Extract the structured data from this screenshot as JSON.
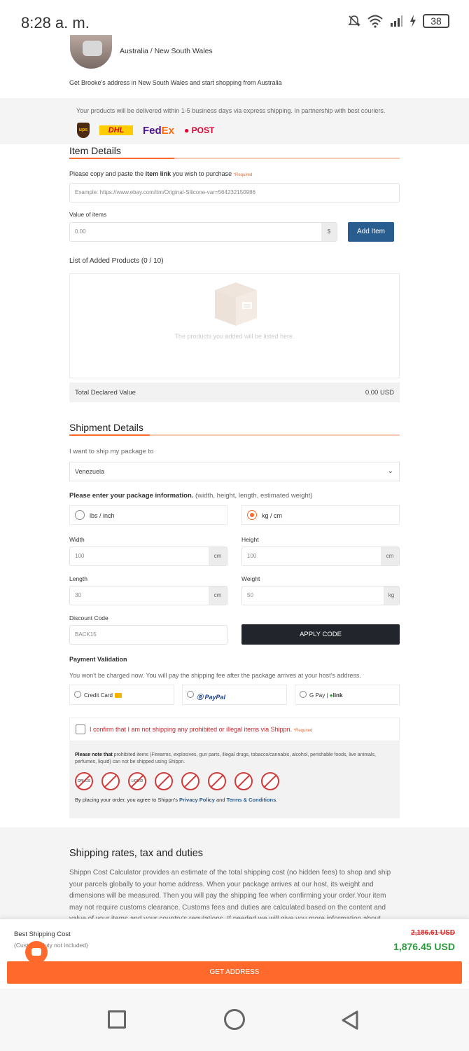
{
  "status_bar": {
    "time": "8:28 a. m.",
    "battery": "38"
  },
  "host": {
    "location": "Australia / New South Wales",
    "description": "Get Brooke's address in New South Wales and start shopping from Australia"
  },
  "delivery": {
    "text": "Your products will be delivered within 1-5 business days via express shipping. In partnership with best couriers.",
    "couriers": [
      "ups",
      "DHL",
      "FedEx",
      "POST"
    ]
  },
  "item_details": {
    "title": "Item Details",
    "link_label_pre": "Please copy and paste the ",
    "link_label_bold": "item link",
    "link_label_post": " you wish to purchase",
    "required": "*Required",
    "link_placeholder": "Example: https://www.ebay.com/itm/Original-Silicone-var=564232150986",
    "value_label": "Value of items",
    "value_placeholder": "0.00",
    "value_suffix": "$",
    "add_button": "Add Item",
    "list_title": "List of Added Products (0 / 10)",
    "empty_text": "The products you added will be listed here.",
    "total_label": "Total Declared Value",
    "total_value": "0.00 USD"
  },
  "shipment": {
    "title": "Shipment Details",
    "ship_to_label": "I want to ship my package to",
    "country": "Venezuela",
    "package_label_bold": "Please enter your package information.",
    "package_label_rest": " (width, height, length, estimated weight)",
    "unit_imperial": "lbs / inch",
    "unit_metric": "kg / cm",
    "width_label": "Width",
    "width_value": "100",
    "height_label": "Height",
    "height_value": "100",
    "length_label": "Length",
    "length_value": "30",
    "weight_label": "Weight",
    "weight_value": "50",
    "unit_cm": "cm",
    "unit_kg": "kg",
    "discount_label": "Discount Code",
    "discount_value": "BACK15",
    "apply_button": "APPLY CODE"
  },
  "payment": {
    "title": "Payment Validation",
    "note": "You won't be charged now. You will pay the shipping fee after the package arrives at your host's address.",
    "credit_card": "Credit Card",
    "paypal": "PayPal",
    "gpay": "G Pay",
    "link": "link"
  },
  "confirm": {
    "text": "I confirm that I am not shipping any prohibited or illegal items via Shippn.",
    "required": "*Required"
  },
  "notice": {
    "bold": "Please note that",
    "text": " prohibited items (Firearms, explosives, gun parts, illegal drugs, tobacco/cannabis, alcohol, perishable foods, live animals, perfumes, liquid) can not be shipped using Shippn.",
    "icons": [
      "DRUGS",
      "",
      "LIQUID",
      "",
      "",
      "",
      "",
      ""
    ],
    "agree_pre": "By placing your order, you agree to Shippn's ",
    "privacy": "Privacy Policy",
    "and": " and ",
    "terms": "Terms & Conditions",
    "period": "."
  },
  "rates": {
    "title": "Shipping rates, tax and duties",
    "body": "Shippn Cost Calculator provides an estimate of the total shipping cost (no hidden fees) to shop and ship your parcels globally to your home address. When your package arrives at our host, its weight and dimensions will be measured. Then you will pay the shipping fee when confirming your order.Your item may not require customs clearance. Customs fees and duties are calculated based on the content and value of your items and your country's regulations. If needed we will give you more information about"
  },
  "summary": {
    "label": "Best Shipping Cost",
    "sub": "(Customs/duty not included)",
    "old_price": "2,186.61 USD",
    "new_price": "1,876.45 USD",
    "button": "GET ADDRESS"
  },
  "colors": {
    "accent": "#ff6a2c",
    "primary_button": "#2a5d8f",
    "dark_button": "#22252b",
    "price_green": "#2e9a3e",
    "price_red": "#d32f2f"
  }
}
